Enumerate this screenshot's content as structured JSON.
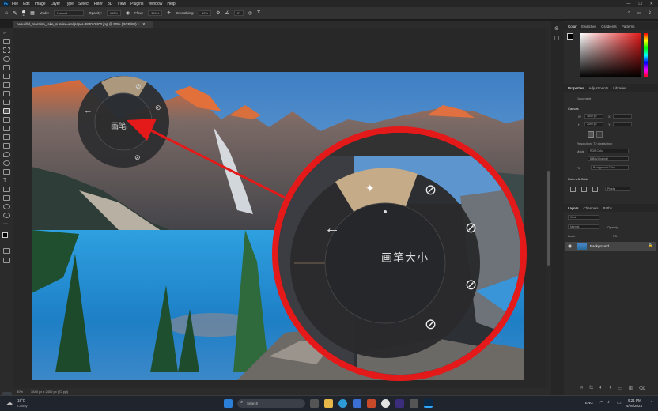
{
  "menu": {
    "items": [
      "File",
      "Edit",
      "Image",
      "Layer",
      "Type",
      "Select",
      "Filter",
      "3D",
      "View",
      "Plugins",
      "Window",
      "Help"
    ]
  },
  "options": {
    "mode_label": "Mode:",
    "mode_value": "Normal",
    "opacity_label": "Opacity:",
    "opacity_value": "100%",
    "flow_label": "Flow:",
    "flow_value": "100%",
    "smoothing_label": "Smoothing:",
    "smoothing_value": "10%",
    "angle_value": "0°",
    "brush_size": "13"
  },
  "document": {
    "tab_title": "beautiful_moraine_lake_sunrise-wallpaper-3840x2400.jpg @ 50% (RGB/8#) *",
    "zoom": "50%",
    "dims": "3840 px x 2400 px (72 ppi)"
  },
  "radial_menu": {
    "center_label": "画笔大小",
    "small_center_label": "画笔"
  },
  "panels": {
    "color_tabs": [
      "Color",
      "Swatches",
      "Gradients",
      "Patterns"
    ],
    "properties_tabs": [
      "Properties",
      "Adjustments",
      "Libraries"
    ],
    "document_label": "Document",
    "canvas_section": "Canvas",
    "w_label": "W",
    "w_value": "3840 px",
    "h_label": "H",
    "h_value": "2400 px",
    "x_label": "X",
    "y_label": "Y",
    "resolution": "Resolution: 72 pixels/inch",
    "mode_label": "Mode",
    "mode_value": "RGB Color",
    "bits_value": "8 Bits/Channel",
    "fill_label": "Fill",
    "fill_value": "Background Color",
    "rulers_section": "Rulers & Grids",
    "units_value": "Pixels",
    "layers_tabs": [
      "Layers",
      "Channels",
      "Paths"
    ],
    "kind_label": "Kind",
    "blend_value": "Normal",
    "opacity_label": "Opacity:",
    "lock_label": "Lock:",
    "fill2_label": "Fill:",
    "layer_name": "Background"
  },
  "taskbar": {
    "weather_temp": "18°C",
    "weather_desc": "Cloudy",
    "search_placeholder": "Search",
    "lang": "ENG",
    "time": "9:21 PM",
    "date": "4/26/2023"
  },
  "colors": {
    "accent": "#e41a1a",
    "panel": "#2b2b2b",
    "ps_blue": "#31a8ff"
  }
}
